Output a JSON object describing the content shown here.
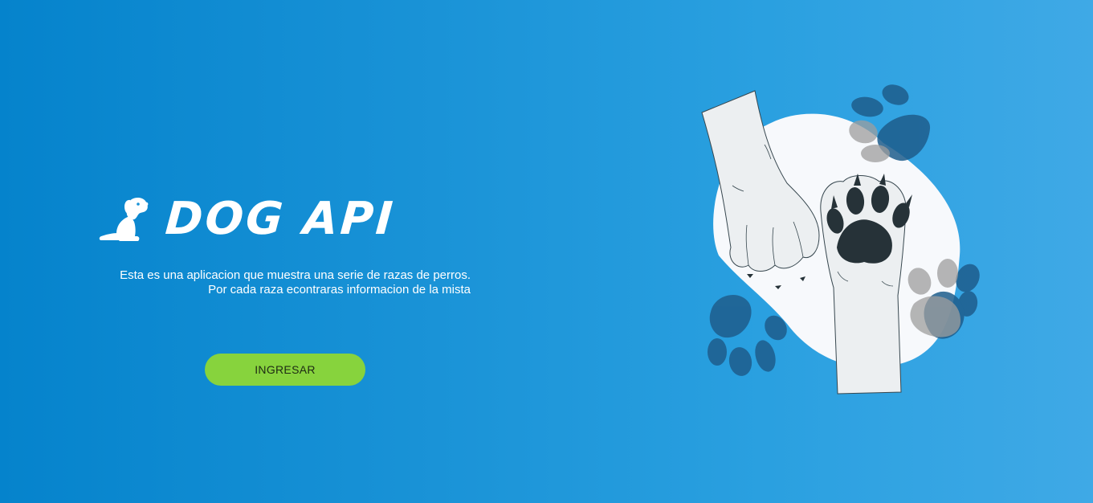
{
  "brand": {
    "logo_icon": "sitting-dog-icon",
    "title": "DOG API"
  },
  "description": {
    "line1": "Esta es una aplicacion que muestra una serie de razas de perros.",
    "line2": "Por cada raza econtraras informacion de la mista"
  },
  "cta": {
    "label": "INGRESAR"
  },
  "illustration": {
    "icon": "dog-paws-illustration"
  },
  "colors": {
    "background_start": "#0583cc",
    "background_end": "#3fa9e6",
    "button": "#87d33d",
    "text": "#ffffff",
    "paw_pad": "#263238"
  }
}
